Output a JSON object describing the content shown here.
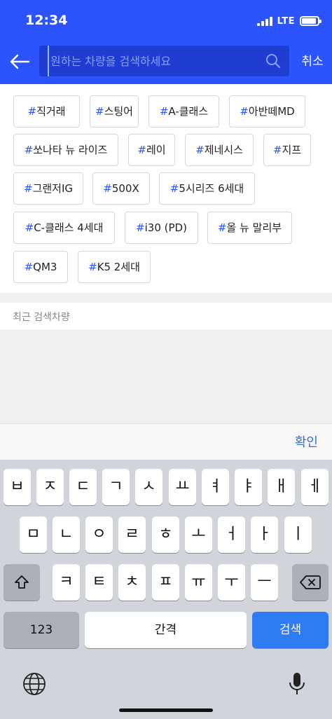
{
  "status": {
    "time": "12:34",
    "network": "LTE"
  },
  "search": {
    "placeholder": "원하는 차량을 검색하세요",
    "value": "",
    "cancel_label": "취소"
  },
  "tags": [
    {
      "hash": "#",
      "label": "직거래"
    },
    {
      "hash": "#",
      "label": "스팅어"
    },
    {
      "hash": "#",
      "label": "A-클래스"
    },
    {
      "hash": "#",
      "label": "아반떼MD"
    },
    {
      "hash": "#",
      "label": "쏘나타 뉴 라이즈"
    },
    {
      "hash": "#",
      "label": "레이"
    },
    {
      "hash": "#",
      "label": "제네시스"
    },
    {
      "hash": "#",
      "label": "지프"
    },
    {
      "hash": "#",
      "label": "그랜저IG"
    },
    {
      "hash": "#",
      "label": "500X"
    },
    {
      "hash": "#",
      "label": "5시리즈 6세대"
    },
    {
      "hash": "#",
      "label": "C-클래스 4세대"
    },
    {
      "hash": "#",
      "label": "i30 (PD)"
    },
    {
      "hash": "#",
      "label": "올 뉴 말리부"
    },
    {
      "hash": "#",
      "label": "QM3"
    },
    {
      "hash": "#",
      "label": "K5 2세대"
    }
  ],
  "recent": {
    "title": "최근 검색차량"
  },
  "confirm": {
    "label": "확인"
  },
  "keyboard": {
    "row1": [
      "ㅂ",
      "ㅈ",
      "ㄷ",
      "ㄱ",
      "ㅅ",
      "ㅛ",
      "ㅕ",
      "ㅑ",
      "ㅐ",
      "ㅔ"
    ],
    "row2": [
      "ㅁ",
      "ㄴ",
      "ㅇ",
      "ㄹ",
      "ㅎ",
      "ㅗ",
      "ㅓ",
      "ㅏ",
      "ㅣ"
    ],
    "row3": [
      "ㅋ",
      "ㅌ",
      "ㅊ",
      "ㅍ",
      "ㅠ",
      "ㅜ",
      "ㅡ"
    ],
    "numbers_label": "123",
    "space_label": "간격",
    "search_label": "검색"
  },
  "colors": {
    "accent": "#2b54ff",
    "hash": "#2b54ff",
    "confirm": "#2f6fd6",
    "search_key": "#2f7bf4"
  }
}
